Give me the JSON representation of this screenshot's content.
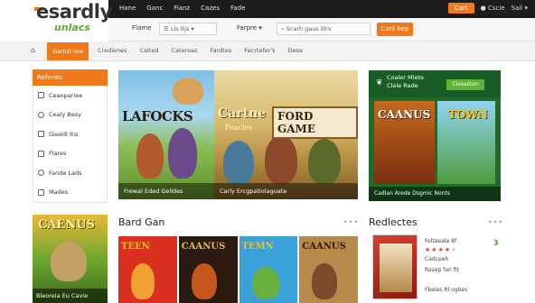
{
  "logo": {
    "brand": "esardly",
    "tagline": "unlacs"
  },
  "topnav": {
    "items": [
      "Hane",
      "Ganc",
      "Fianz",
      "Cazes",
      "Fade"
    ]
  },
  "top_right": {
    "cart_label": "Cart",
    "account": "Cscie",
    "sign": "Saii"
  },
  "search_row": {
    "label1": "Flame",
    "select1": "Lls ltjs",
    "label2": "Farpre",
    "input_placeholder": "Scarh gaus lllrs",
    "search_button": "Canl hep"
  },
  "categories": {
    "home_glyph": "⌂",
    "active": "Gamsl Iwo",
    "items": [
      "Credienes",
      "Calted",
      "Cateroas",
      "Fardtes",
      "Fecrtefer's",
      "Dese"
    ]
  },
  "sidebar": {
    "heading": "Refenes",
    "items": [
      "Ceanpariee",
      "Cealy Besy",
      "Gieedl itis",
      "Flares",
      "Fande Lads",
      "Mades"
    ]
  },
  "hero": {
    "title_left": "LAFOCKS",
    "title_mid": "Cartne",
    "title_mid_sub": "Feacles",
    "title_right": "FORD GAME",
    "caption_left": "Frewal Eded Gelldes",
    "caption_right": "Carly Ercgpatiolaguate"
  },
  "promo": {
    "line1": "Coaler Mlete",
    "line2": "Clele Rade",
    "button": "Clesaiiten",
    "title_left": "CAANUS",
    "title_right": "TOWN",
    "caption": "Cadlan Arede Dsgmic Nonts"
  },
  "bottom_left": {
    "title": "CAENUS",
    "caption": "Bleoreia Eu Cavie"
  },
  "board_games": {
    "heading": "Bard Gan",
    "more": "•••",
    "cards": [
      {
        "title": "TEEN",
        "bg": "#d9301f",
        "fg": "#f2c21f"
      },
      {
        "title": "CAANUS",
        "bg": "#2a1a10",
        "fg": "#e8b838"
      },
      {
        "title": "TEMN",
        "bg": "#3aa0d8",
        "fg": "#f2c21f"
      },
      {
        "title": "CAANUS",
        "bg": "#b58a4a",
        "fg": "#3a1a05"
      }
    ]
  },
  "recommended": {
    "heading": "Redlectes",
    "more": "•••",
    "line1": "Feltaeale 8f",
    "line2": "Cadcpeh",
    "line3": "Rasep fan fit",
    "line4": "Fbeles Rl ogbes",
    "rating": 4,
    "count": "3"
  }
}
